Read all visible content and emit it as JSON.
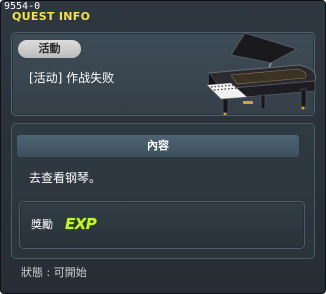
{
  "window": {
    "quest_id": "9554-0",
    "title": "QUEST INFO"
  },
  "header": {
    "tag": "活動",
    "quest_name": "[活动] 作战失败",
    "image_icon": "grand-piano-icon"
  },
  "content": {
    "header_label": "內容",
    "description": "去查看钢琴。"
  },
  "reward": {
    "label": "獎勵",
    "icon": "exp-icon",
    "icon_text": "EXP"
  },
  "status": {
    "text": "狀態 : 可開始"
  },
  "colors": {
    "title_yellow": "#f2e34a",
    "panel_bg": "#2f3740",
    "exp_green": "#c8f23a"
  }
}
